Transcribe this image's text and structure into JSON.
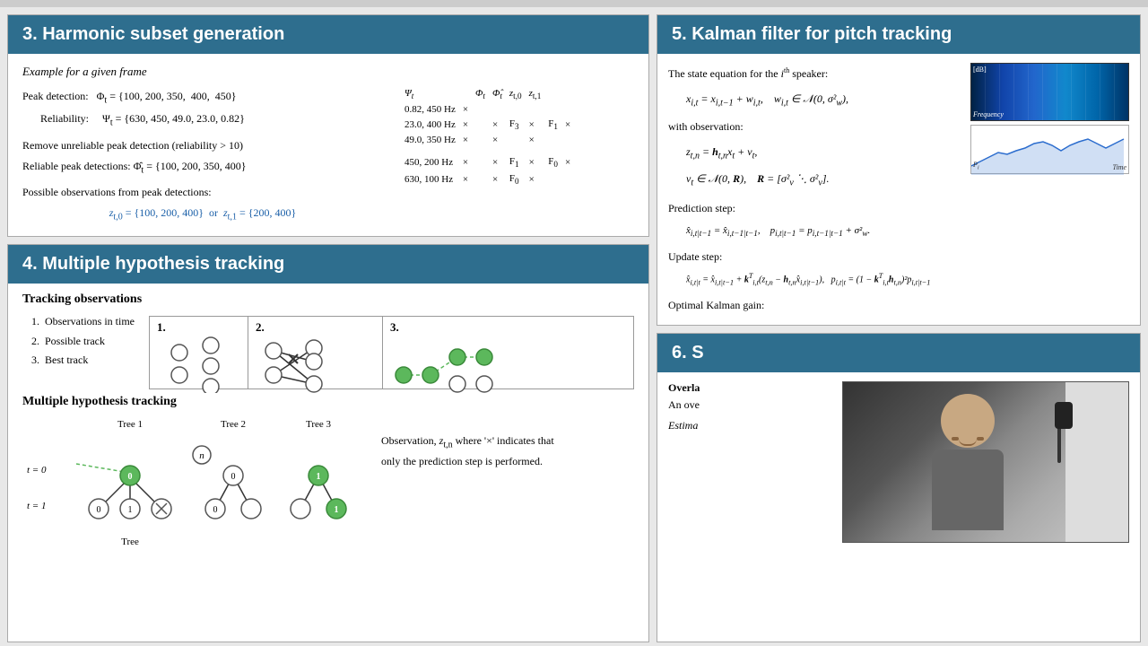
{
  "sections": {
    "s3": {
      "header": "3. Harmonic subset generation",
      "example_title": "Example for a given frame",
      "peak_detection": "Peak detection:   Φ_t = {100, 200, 350,  400,  450}",
      "reliability": "Reliability:      Ψ_t = {630, 450, 49.0, 23.0, 0.82}",
      "remove_text": "Remove unreliable peak detection (reliability > 10)",
      "reliable_text": "Reliable peak detections: Φ̂_t = {100, 200, 350, 400}",
      "possible_text": "Possible observations from peak detections:",
      "obs_formula": "z_{t,0} = {100, 200, 400}  or  z_{t,1} = {200, 400}"
    },
    "s4": {
      "header": "4. Multiple hypothesis tracking",
      "tracking_obs_title": "Tracking observations",
      "obs_list": [
        "1.  Observations in time",
        "2.  Possible track",
        "3.  Best track"
      ],
      "mht_title": "Multiple hypothesis tracking",
      "mht_desc": "Observation, z_{t,n} where '×' indicates that only the prediction step is performed.",
      "tree_labels": [
        "Tree 1",
        "Tree 2",
        "Tree 3"
      ],
      "t_labels": [
        "t = 0",
        "t = 1"
      ]
    },
    "s5": {
      "header": "5. Kalman filter for pitch tracking",
      "state_eq": "The state equation for the i",
      "state_sup": "th",
      "state_eq2": " speaker:",
      "eq1": "x_{i,t} = x_{i,t−1} + w_{i,t},   w_{i,t} ∈ 𝒩(0, σ²_w),",
      "with_obs": "with observation:",
      "eq2": "z_{t,n} = h_{t,n} x_t + v_t,",
      "eq3": "v_t ∈ 𝒩(0, R),   R = [σ²_v ⋱ σ²_v].",
      "pred_step": "Prediction step:",
      "eq4": "x̂_{i,t|t−1} = x̂_{i,t−1|t−1},   p_{i,t|t−1} = p_{i,t−1|t−1} + σ²_w.",
      "update_step": "Update step:",
      "eq5": "x̂_{i,t|t} = x̂_{i,t|t−1} + k^T_{i,t}(z_{t,n} − h_{t,n} x̂_{i,t|t−1}),   p_{i,t|t} = (1 − k^T_{i,t} h_{t,n})² p_{i,t|t−1}",
      "kalman_gain": "Optimal Kalman gain:",
      "estima": "Estima"
    },
    "s6": {
      "header": "6. S",
      "overlap": "Overla",
      "an_ove": "An ove"
    }
  }
}
